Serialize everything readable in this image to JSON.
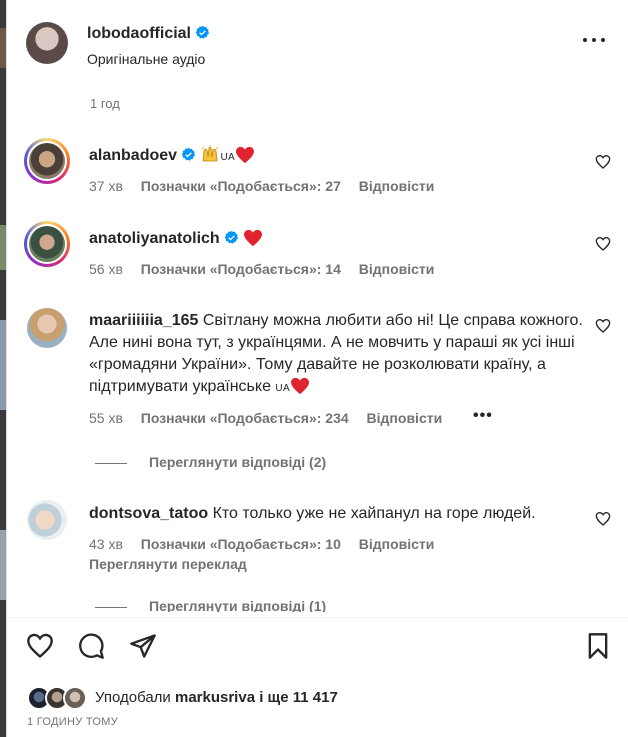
{
  "header": {
    "username": "lobodaofficial",
    "subtitle": "Оригінальне аудіо"
  },
  "caption_time": "1 год",
  "comments": [
    {
      "user": "alanbadoev",
      "verified": true,
      "text_suffix": "UA",
      "time": "37 хв",
      "likes": "Позначки «Подобається»: 27",
      "reply": "Відповісти"
    },
    {
      "user": "anatoliyanatolich",
      "verified": true,
      "text_suffix": "",
      "time": "56 хв",
      "likes": "Позначки «Подобається»: 14",
      "reply": "Відповісти"
    },
    {
      "user": "maariiiiiia_165",
      "text": "Світлану можна любити або ні! Це справа кожного. Але нині вона тут, з українцями. А не мовчить у параші як усі інші «громадяни України». Тому давайте не розколювати країну, а підтримувати українське",
      "text_suffix": "UA",
      "time": "55 хв",
      "likes": "Позначки «Подобається»: 234",
      "reply": "Відповісти",
      "view_replies": "Переглянути відповіді (2)"
    },
    {
      "user": "dontsova_tatoo",
      "text": "Кто только уже не хайпанул на горе людей.",
      "time": "43 хв",
      "likes": "Позначки «Подобається»: 10",
      "reply": "Відповісти",
      "translate": "Переглянути переклад",
      "view_replies": "Переглянути відповіді (1)"
    }
  ],
  "liked_by": {
    "prefix": "Уподобали",
    "user": "markusriva",
    "middle": "і ще",
    "count": "11 417"
  },
  "timestamp": "1 ГОДИНУ ТОМУ",
  "colors": {
    "text": "#262626",
    "muted": "#737373",
    "verified": "#0095f6",
    "heart": "#ed4956"
  },
  "icons": [
    "verified-icon",
    "more-icon",
    "heart-icon",
    "comment-icon",
    "share-icon",
    "bookmark-icon",
    "raised-hands-emoji",
    "red-heart-emoji"
  ]
}
